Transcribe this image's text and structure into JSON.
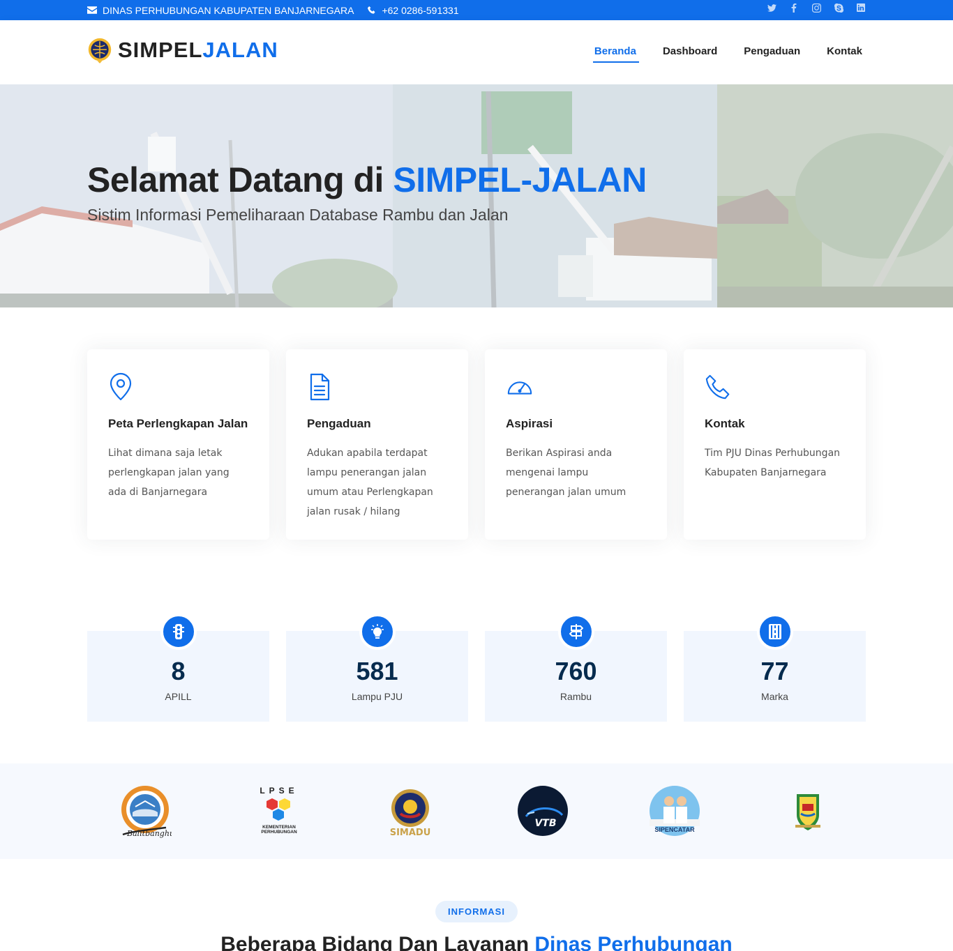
{
  "topbar": {
    "org": "DINAS PERHUBUNGAN KABUPATEN BANJARNEGARA",
    "phone": "+62 0286-591331",
    "social": [
      "twitter-icon",
      "facebook-icon",
      "instagram-icon",
      "skype-icon",
      "linkedin-icon"
    ]
  },
  "header": {
    "logo_part1": "SIMPEL",
    "logo_part2": "JALAN",
    "nav": [
      "Beranda",
      "Dashboard",
      "Pengaduan",
      "Kontak"
    ],
    "active_nav": "Beranda"
  },
  "hero": {
    "title_part1": "Selamat Datang di ",
    "title_part2": "SIMPEL-JALAN",
    "subtitle": "Sistim Informasi Pemeliharaan Database Rambu dan Jalan"
  },
  "features": [
    {
      "icon": "map-pin-icon",
      "title": "Peta Perlengkapan Jalan",
      "text": "Lihat dimana saja letak perlengkapan jalan yang ada di Banjarnegara"
    },
    {
      "icon": "document-icon",
      "title": "Pengaduan",
      "text": "Adukan apabila terdapat lampu penerangan jalan umum atau Perlengkapan jalan rusak / hilang"
    },
    {
      "icon": "speedometer-icon",
      "title": "Aspirasi",
      "text": "Berikan Aspirasi anda mengenai lampu penerangan jalan umum"
    },
    {
      "icon": "phone-icon",
      "title": "Kontak",
      "text": "Tim PJU Dinas Perhubungan Kabupaten Banjarnegara"
    }
  ],
  "counts": [
    {
      "icon": "traffic-light-icon",
      "value": "8",
      "label": "APILL"
    },
    {
      "icon": "lightbulb-icon",
      "value": "581",
      "label": "Lampu PJU"
    },
    {
      "icon": "signpost-icon",
      "value": "760",
      "label": "Rambu"
    },
    {
      "icon": "road-icon",
      "value": "77",
      "label": "Marka"
    }
  ],
  "clients": {
    "balitbanghub_logo_text": "Balitbanghub",
    "lpse_top": "LPSE",
    "lpse_bottom": "KEMENTERIAN PERHUBUNGAN",
    "simadu": "SIMADU",
    "vtb": "VTB",
    "sipencatar": "SIPENCATAR"
  },
  "section": {
    "badge": "INFORMASI",
    "title_part1": "Beberapa Bidang Dan Layanan ",
    "title_part2": "Dinas Perhubungan"
  },
  "colors": {
    "accent": "#106eea",
    "count_bg": "#f1f6fe",
    "clients_bg": "#f6f9fe"
  }
}
